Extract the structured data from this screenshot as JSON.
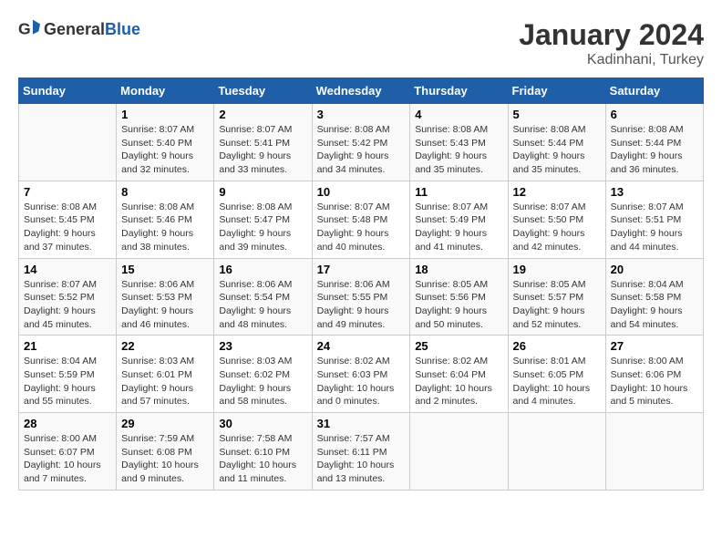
{
  "header": {
    "logo_general": "General",
    "logo_blue": "Blue",
    "title": "January 2024",
    "subtitle": "Kadinhani, Turkey"
  },
  "calendar": {
    "days_of_week": [
      "Sunday",
      "Monday",
      "Tuesday",
      "Wednesday",
      "Thursday",
      "Friday",
      "Saturday"
    ],
    "weeks": [
      [
        {
          "day": "",
          "info": ""
        },
        {
          "day": "1",
          "info": "Sunrise: 8:07 AM\nSunset: 5:40 PM\nDaylight: 9 hours\nand 32 minutes."
        },
        {
          "day": "2",
          "info": "Sunrise: 8:07 AM\nSunset: 5:41 PM\nDaylight: 9 hours\nand 33 minutes."
        },
        {
          "day": "3",
          "info": "Sunrise: 8:08 AM\nSunset: 5:42 PM\nDaylight: 9 hours\nand 34 minutes."
        },
        {
          "day": "4",
          "info": "Sunrise: 8:08 AM\nSunset: 5:43 PM\nDaylight: 9 hours\nand 35 minutes."
        },
        {
          "day": "5",
          "info": "Sunrise: 8:08 AM\nSunset: 5:44 PM\nDaylight: 9 hours\nand 35 minutes."
        },
        {
          "day": "6",
          "info": "Sunrise: 8:08 AM\nSunset: 5:44 PM\nDaylight: 9 hours\nand 36 minutes."
        }
      ],
      [
        {
          "day": "7",
          "info": "Sunrise: 8:08 AM\nSunset: 5:45 PM\nDaylight: 9 hours\nand 37 minutes."
        },
        {
          "day": "8",
          "info": "Sunrise: 8:08 AM\nSunset: 5:46 PM\nDaylight: 9 hours\nand 38 minutes."
        },
        {
          "day": "9",
          "info": "Sunrise: 8:08 AM\nSunset: 5:47 PM\nDaylight: 9 hours\nand 39 minutes."
        },
        {
          "day": "10",
          "info": "Sunrise: 8:07 AM\nSunset: 5:48 PM\nDaylight: 9 hours\nand 40 minutes."
        },
        {
          "day": "11",
          "info": "Sunrise: 8:07 AM\nSunset: 5:49 PM\nDaylight: 9 hours\nand 41 minutes."
        },
        {
          "day": "12",
          "info": "Sunrise: 8:07 AM\nSunset: 5:50 PM\nDaylight: 9 hours\nand 42 minutes."
        },
        {
          "day": "13",
          "info": "Sunrise: 8:07 AM\nSunset: 5:51 PM\nDaylight: 9 hours\nand 44 minutes."
        }
      ],
      [
        {
          "day": "14",
          "info": "Sunrise: 8:07 AM\nSunset: 5:52 PM\nDaylight: 9 hours\nand 45 minutes."
        },
        {
          "day": "15",
          "info": "Sunrise: 8:06 AM\nSunset: 5:53 PM\nDaylight: 9 hours\nand 46 minutes."
        },
        {
          "day": "16",
          "info": "Sunrise: 8:06 AM\nSunset: 5:54 PM\nDaylight: 9 hours\nand 48 minutes."
        },
        {
          "day": "17",
          "info": "Sunrise: 8:06 AM\nSunset: 5:55 PM\nDaylight: 9 hours\nand 49 minutes."
        },
        {
          "day": "18",
          "info": "Sunrise: 8:05 AM\nSunset: 5:56 PM\nDaylight: 9 hours\nand 50 minutes."
        },
        {
          "day": "19",
          "info": "Sunrise: 8:05 AM\nSunset: 5:57 PM\nDaylight: 9 hours\nand 52 minutes."
        },
        {
          "day": "20",
          "info": "Sunrise: 8:04 AM\nSunset: 5:58 PM\nDaylight: 9 hours\nand 54 minutes."
        }
      ],
      [
        {
          "day": "21",
          "info": "Sunrise: 8:04 AM\nSunset: 5:59 PM\nDaylight: 9 hours\nand 55 minutes."
        },
        {
          "day": "22",
          "info": "Sunrise: 8:03 AM\nSunset: 6:01 PM\nDaylight: 9 hours\nand 57 minutes."
        },
        {
          "day": "23",
          "info": "Sunrise: 8:03 AM\nSunset: 6:02 PM\nDaylight: 9 hours\nand 58 minutes."
        },
        {
          "day": "24",
          "info": "Sunrise: 8:02 AM\nSunset: 6:03 PM\nDaylight: 10 hours\nand 0 minutes."
        },
        {
          "day": "25",
          "info": "Sunrise: 8:02 AM\nSunset: 6:04 PM\nDaylight: 10 hours\nand 2 minutes."
        },
        {
          "day": "26",
          "info": "Sunrise: 8:01 AM\nSunset: 6:05 PM\nDaylight: 10 hours\nand 4 minutes."
        },
        {
          "day": "27",
          "info": "Sunrise: 8:00 AM\nSunset: 6:06 PM\nDaylight: 10 hours\nand 5 minutes."
        }
      ],
      [
        {
          "day": "28",
          "info": "Sunrise: 8:00 AM\nSunset: 6:07 PM\nDaylight: 10 hours\nand 7 minutes."
        },
        {
          "day": "29",
          "info": "Sunrise: 7:59 AM\nSunset: 6:08 PM\nDaylight: 10 hours\nand 9 minutes."
        },
        {
          "day": "30",
          "info": "Sunrise: 7:58 AM\nSunset: 6:10 PM\nDaylight: 10 hours\nand 11 minutes."
        },
        {
          "day": "31",
          "info": "Sunrise: 7:57 AM\nSunset: 6:11 PM\nDaylight: 10 hours\nand 13 minutes."
        },
        {
          "day": "",
          "info": ""
        },
        {
          "day": "",
          "info": ""
        },
        {
          "day": "",
          "info": ""
        }
      ]
    ]
  }
}
